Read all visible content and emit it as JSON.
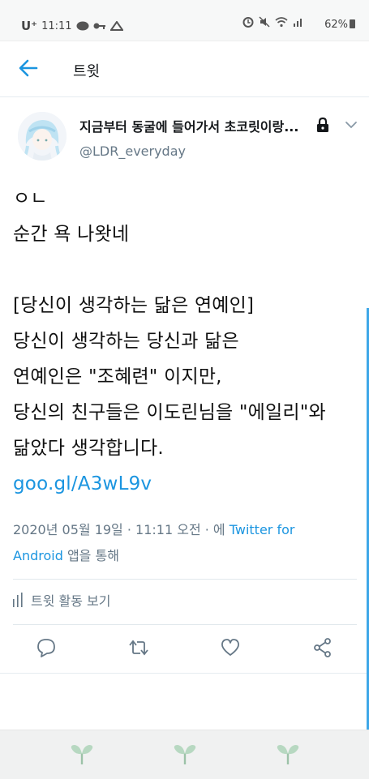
{
  "status_bar": {
    "carrier": "U⁺",
    "time": "11:11",
    "battery": "62%"
  },
  "header": {
    "title": "트윗"
  },
  "tweet": {
    "display_name": "지금부터 동굴에 들어가서 초코릿이랑...",
    "handle": "@LDR_everyday",
    "lines": [
      "ㅇㄴ",
      "순간 욕 나왓네",
      "",
      "[당신이 생각하는 닮은 연예인]",
      "당신이 생각하는 당신과 닮은",
      "연예인은 \"조혜련\" 이지만,",
      "당신의 친구들은 이도린님을 \"에일리\"와",
      "닮았다 생각합니다."
    ],
    "link": "goo.gl/A3wL9v",
    "timestamp": "2020년 05월 19일 · 11:11 오전 · 에 ",
    "via_line1": "Twitter for",
    "via_line2": "Android",
    "via_suffix": " 앱을 통해",
    "activity_label": "트윗 활동 보기"
  },
  "colors": {
    "accent": "#1b95e0",
    "secondary_text": "#657786"
  },
  "icons": {
    "back": "arrow-left-icon",
    "lock": "lock-icon",
    "more": "chevron-down-icon",
    "reply": "reply-icon",
    "retweet": "retweet-icon",
    "like": "heart-icon",
    "share": "share-icon",
    "activity": "bar-chart-icon",
    "nav": "sprout-icon"
  }
}
